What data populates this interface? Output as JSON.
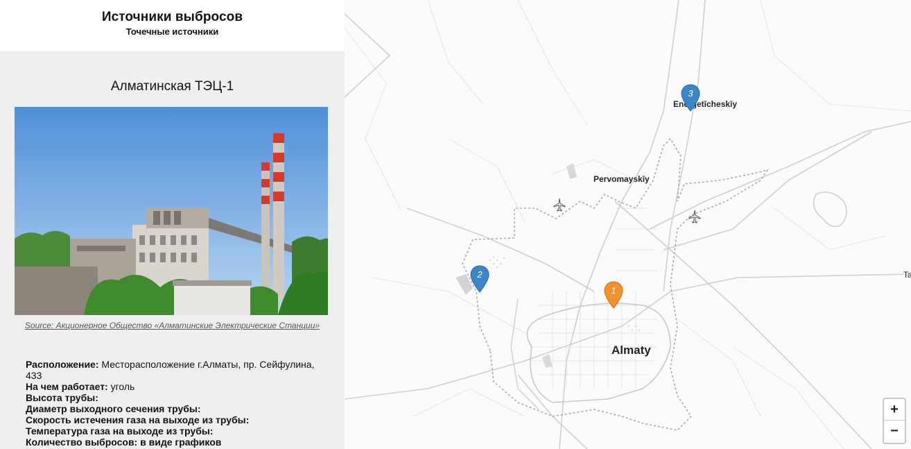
{
  "header": {
    "title": "Источники выбросов",
    "subtitle": "Точечные источники"
  },
  "source": {
    "name": "Алматинская ТЭЦ-1",
    "photo_alt": "Алматинская ТЭЦ-1",
    "credit": "Source: Акционерное Общество «Алматинские Электрические Станции»",
    "fields": {
      "location_label": "Расположение:",
      "location_value": " Месторасположение г.Алматы, пр. Сейфулина, 433",
      "fuel_label": "На чем работает:",
      "fuel_value": " уголь",
      "height_label": "Высота трубы:",
      "diameter_label": "Диаметр выходного сечения трубы:",
      "speed_label": "Скорость истечения газа на выходе из трубы:",
      "temp_label": "Температура газа на выходе из трубы:",
      "emissions_label": "Количество выбросов: в виде графиков"
    }
  },
  "map": {
    "places": {
      "energetic": "Energetīcheskīy",
      "pervomay": "Pervomayskīy",
      "almaty": "Almaty",
      "ta": "Ta"
    },
    "markers": [
      {
        "num": "1",
        "color": "#f0932f",
        "active": true
      },
      {
        "num": "2",
        "color": "#3a86c8",
        "active": false
      },
      {
        "num": "3",
        "color": "#3a86c8",
        "active": false
      }
    ],
    "zoom_in": "+",
    "zoom_out": "−",
    "airport_icon": "airplane-icon"
  },
  "colors": {
    "panel_bg": "#efefef",
    "marker_orange": "#f0932f",
    "marker_blue": "#3a86c8"
  }
}
